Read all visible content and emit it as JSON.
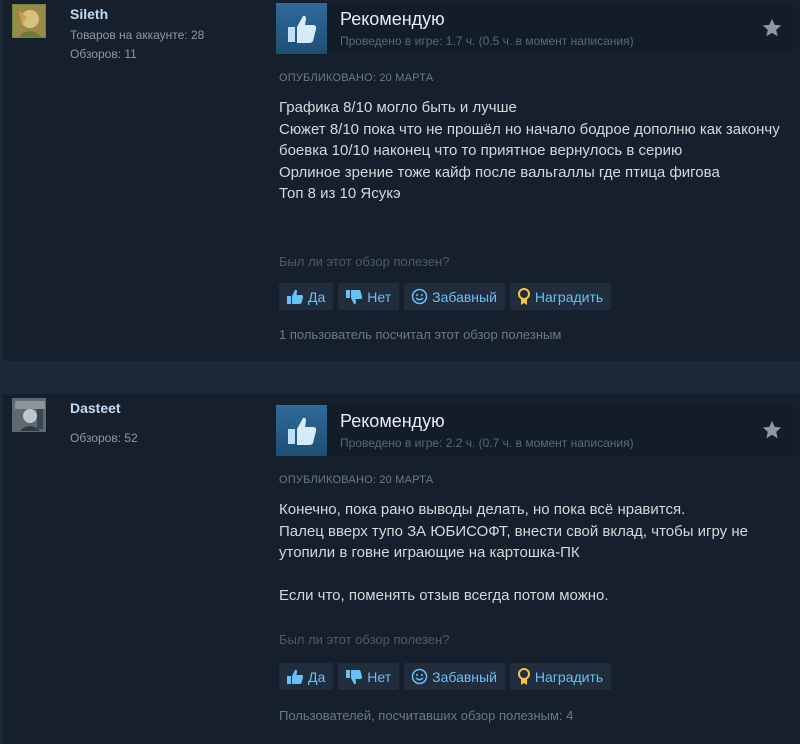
{
  "colors": {
    "link": "#67c1f5",
    "panel": "#16202d",
    "page": "#1b2838"
  },
  "reviews": [
    {
      "persona": "Sileth",
      "owned": "Товаров на аккаунте: 28",
      "num_reviews": "Обзоров: 11",
      "title": "Рекомендую",
      "hours": "Проведено в игре: 1.7 ч. (0.5 ч. в момент написания)",
      "posted": "Опубликовано: 20 марта",
      "body": [
        "Графика 8/10 могло быть и лучше",
        "Сюжет 8/10 пока что не прошёл но начало бодрое дополню как закончу",
        "боевка 10/10 наконец что то приятное вернулось в серию",
        "Орлиное зрение тоже кайф после вальгаллы где птица фигова",
        "Топ 8 из 10 Ясукэ"
      ],
      "helpful_question": "Был ли этот обзор полезен?",
      "buttons": {
        "yes": "Да",
        "no": "Нет",
        "funny": "Забавный",
        "award": "Наградить"
      },
      "helpful_count": "1 пользователь посчитал этот обзор полезным",
      "icons": [
        "thumbs-up-icon",
        "star-icon",
        "avatar"
      ]
    },
    {
      "persona": "Dasteet",
      "num_reviews": "Обзоров: 52",
      "title": "Рекомендую",
      "hours": "Проведено в игре: 2.2 ч. (0.7 ч. в момент написания)",
      "posted": "Опубликовано: 20 марта",
      "body": [
        "Конечно, пока рано выводы делать, но пока всё нравится.",
        "Палец вверх тупо ЗА ЮБИСОФТ, внести свой вклад, чтобы игру не утопили в говне играющие на картошка-ПК",
        "",
        "Если что, поменять отзыв всегда потом можно."
      ],
      "helpful_question": "Был ли этот обзор полезен?",
      "buttons": {
        "yes": "Да",
        "no": "Нет",
        "funny": "Забавный",
        "award": "Наградить"
      },
      "helpful_count": "Пользователей, посчитавших обзор полезным: 4",
      "icons": [
        "thumbs-up-icon",
        "star-icon",
        "avatar"
      ]
    }
  ]
}
